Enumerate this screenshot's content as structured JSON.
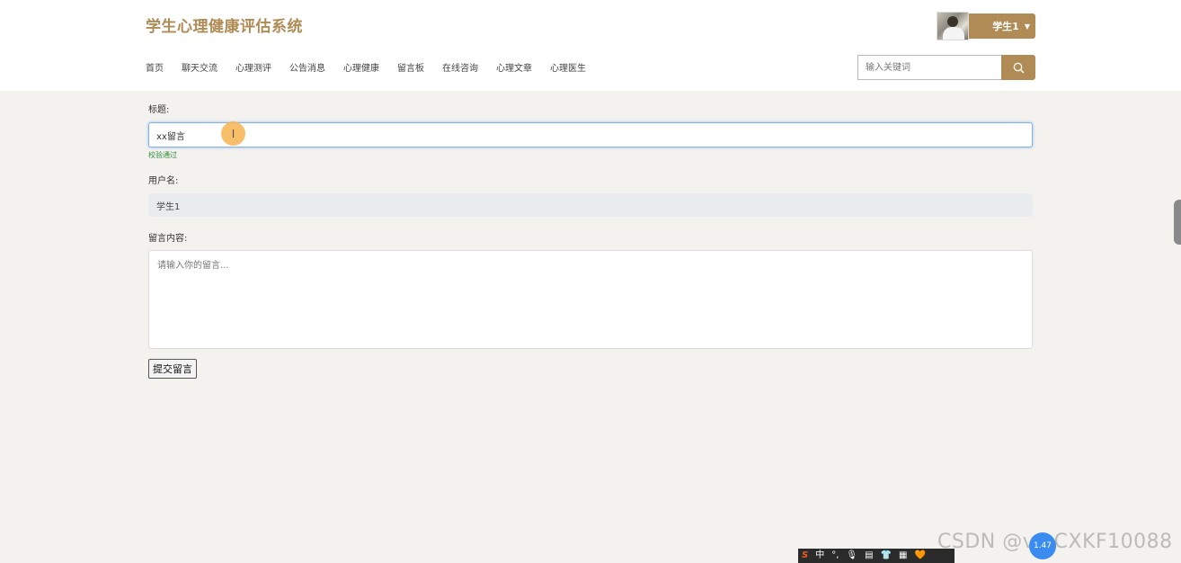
{
  "header": {
    "site_title": "学生心理健康评估系统",
    "user_name": "学生1",
    "user_caret": "▼"
  },
  "nav": {
    "items": [
      "首页",
      "聊天交流",
      "心理测评",
      "公告消息",
      "心理健康",
      "留言板",
      "在线咨询",
      "心理文章",
      "心理医生"
    ]
  },
  "search": {
    "placeholder": "输入关键词",
    "icon": "search-icon"
  },
  "form": {
    "title_label": "标题:",
    "title_value": "xx留言",
    "validation_text": "校验通过",
    "username_label": "用户名:",
    "username_value": "学生1",
    "content_label": "留言内容:",
    "content_placeholder": "请输入你的留言...",
    "submit_label": "提交留言"
  },
  "overlay": {
    "watermark": "CSDN @vx:CXKF10088",
    "bubble_text": "1.47",
    "ime_items": [
      "S",
      "中",
      "°,",
      "🎙",
      "▤",
      "👕",
      "▦",
      "🧡"
    ]
  },
  "colors": {
    "accent": "#b08b55",
    "page_bg": "#f3f2ef",
    "valid_green": "#2e8b3a"
  }
}
